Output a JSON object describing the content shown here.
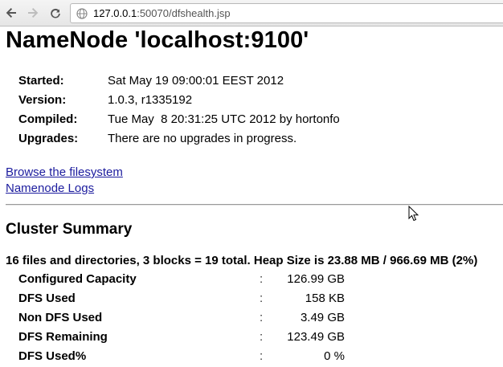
{
  "browser": {
    "url_host": "127.0.0.1",
    "url_rest": ":50070/dfshealth.jsp",
    "icons": [
      "back-arrow-icon",
      "forward-arrow-icon",
      "reload-icon",
      "globe-icon"
    ]
  },
  "page": {
    "title": "NameNode 'localhost:9100'",
    "info": [
      {
        "label": "Started:",
        "value": "Sat May 19 09:00:01 EEST 2012"
      },
      {
        "label": "Version:",
        "value": "1.0.3, r1335192"
      },
      {
        "label": "Compiled:",
        "value": "Tue May  8 20:31:25 UTC 2012 by hortonfo"
      },
      {
        "label": "Upgrades:",
        "value": "There are no upgrades in progress."
      }
    ],
    "links": {
      "browse": "Browse the filesystem",
      "logs": "Namenode Logs"
    },
    "cluster": {
      "heading": "Cluster Summary",
      "summary": "16 files and directories, 3 blocks = 19 total. Heap Size is 23.88 MB / 966.69 MB (2%)",
      "rows": [
        {
          "label": "Configured Capacity",
          "sep": ":",
          "value": "126.99 GB"
        },
        {
          "label": "DFS Used",
          "sep": ":",
          "value": "158 KB"
        },
        {
          "label": "Non DFS Used",
          "sep": ":",
          "value": "3.49 GB"
        },
        {
          "label": "DFS Remaining",
          "sep": ":",
          "value": "123.49 GB"
        },
        {
          "label": "DFS Used%",
          "sep": ":",
          "value": "0 %"
        }
      ]
    }
  },
  "colors": {
    "link": "#1c1c9e",
    "rule": "#9a9a9a"
  }
}
